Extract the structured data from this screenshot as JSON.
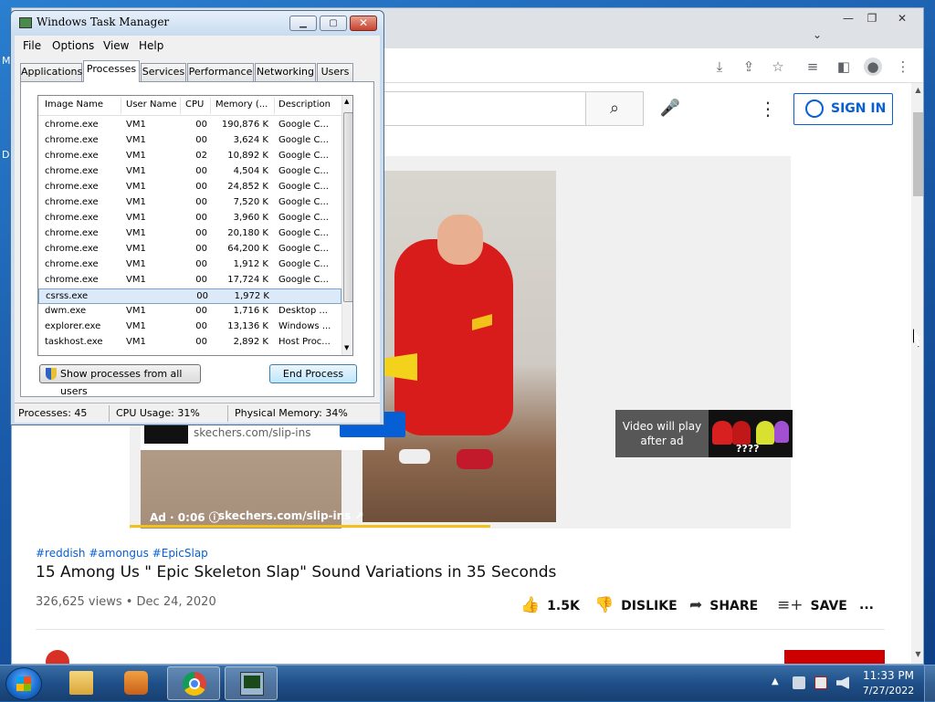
{
  "desktop": {
    "edge_text_m": "M",
    "edge_text_d": "D"
  },
  "chrome": {
    "window_buttons": {
      "minimize": "—",
      "maximize": "❐",
      "close": "✕"
    },
    "tab_dropdown": "⌄",
    "toolbar_icons": [
      "download-icon",
      "share-icon",
      "star-icon",
      "media-icon",
      "sidepanel-icon",
      "profile-icon",
      "menu-icon"
    ]
  },
  "youtube": {
    "sign_in": "SIGN IN",
    "search_icon": "⌕",
    "mic_icon": "🎤",
    "more_icon": "⋮",
    "ad": {
      "overlay_url": "skechers.com/slip-ins",
      "info_time": "Ad · 0:06  ⓘ",
      "info_url": "skechers.com/slip-ins ↗",
      "panel_text": "Video will play after ad",
      "thumb_text": "????"
    },
    "hashtags": "#reddish #amongus #EpicSlap",
    "title": "15 Among Us \" Epic Skeleton Slap\" Sound Variations in 35 Seconds",
    "meta": "326,625 views • Dec 24, 2020",
    "actions": {
      "likes": "1.5K",
      "dislike": "DISLIKE",
      "share": "SHARE",
      "save": "SAVE",
      "more": "..."
    }
  },
  "taskmgr": {
    "title": "Windows Task Manager",
    "window_buttons": {
      "minimize": "▁",
      "maximize": "▢",
      "close": "✕"
    },
    "menu": [
      "File",
      "Options",
      "View",
      "Help"
    ],
    "tabs": [
      "Applications",
      "Processes",
      "Services",
      "Performance",
      "Networking",
      "Users"
    ],
    "active_tab": "Processes",
    "columns": [
      "Image Name",
      "User Name",
      "CPU",
      "Memory (...",
      "Description"
    ],
    "rows": [
      {
        "name": "chrome.exe",
        "user": "VM1",
        "cpu": "00",
        "mem": "190,876 K",
        "desc": "Google C..."
      },
      {
        "name": "chrome.exe",
        "user": "VM1",
        "cpu": "00",
        "mem": "3,624 K",
        "desc": "Google C..."
      },
      {
        "name": "chrome.exe",
        "user": "VM1",
        "cpu": "02",
        "mem": "10,892 K",
        "desc": "Google C..."
      },
      {
        "name": "chrome.exe",
        "user": "VM1",
        "cpu": "00",
        "mem": "4,504 K",
        "desc": "Google C..."
      },
      {
        "name": "chrome.exe",
        "user": "VM1",
        "cpu": "00",
        "mem": "24,852 K",
        "desc": "Google C..."
      },
      {
        "name": "chrome.exe",
        "user": "VM1",
        "cpu": "00",
        "mem": "7,520 K",
        "desc": "Google C..."
      },
      {
        "name": "chrome.exe",
        "user": "VM1",
        "cpu": "00",
        "mem": "3,960 K",
        "desc": "Google C..."
      },
      {
        "name": "chrome.exe",
        "user": "VM1",
        "cpu": "00",
        "mem": "20,180 K",
        "desc": "Google C..."
      },
      {
        "name": "chrome.exe",
        "user": "VM1",
        "cpu": "00",
        "mem": "64,200 K",
        "desc": "Google C..."
      },
      {
        "name": "chrome.exe",
        "user": "VM1",
        "cpu": "00",
        "mem": "1,912 K",
        "desc": "Google C..."
      },
      {
        "name": "chrome.exe",
        "user": "VM1",
        "cpu": "00",
        "mem": "17,724 K",
        "desc": "Google C..."
      },
      {
        "name": "csrss.exe",
        "user": "",
        "cpu": "00",
        "mem": "1,972 K",
        "desc": "",
        "selected": true
      },
      {
        "name": "dwm.exe",
        "user": "VM1",
        "cpu": "00",
        "mem": "1,716 K",
        "desc": "Desktop ..."
      },
      {
        "name": "explorer.exe",
        "user": "VM1",
        "cpu": "00",
        "mem": "13,136 K",
        "desc": "Windows ..."
      },
      {
        "name": "taskhost.exe",
        "user": "VM1",
        "cpu": "00",
        "mem": "2,892 K",
        "desc": "Host Proc..."
      }
    ],
    "show_all_button": "Show processes from all users",
    "end_process_button": "End Process",
    "status": {
      "processes": "Processes: 45",
      "cpu": "CPU Usage: 31%",
      "memory": "Physical Memory: 34%"
    }
  },
  "taskbar": {
    "items": [
      "start",
      "file-explorer",
      "media-player",
      "chrome",
      "task-manager"
    ],
    "tray_arrow": "▲",
    "clock_time": "11:33 PM",
    "clock_date": "7/27/2022"
  }
}
